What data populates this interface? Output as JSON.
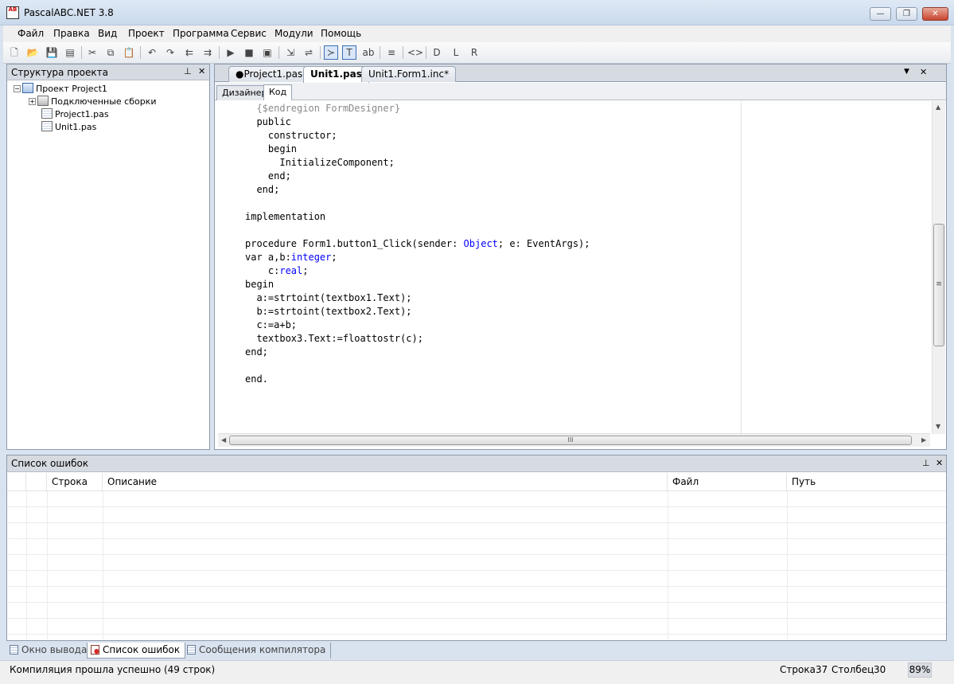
{
  "window": {
    "title": "PascalABC.NET 3.8",
    "icon_text": "AB",
    "minimize_glyph": "—",
    "restore_glyph": "❐",
    "close_glyph": "✕"
  },
  "menu": [
    "Файл",
    "Правка",
    "Вид",
    "Проект",
    "Программа",
    "Сервис",
    "Модули",
    "Помощь"
  ],
  "toolbar": {
    "icons": [
      "new-file-icon",
      "open-folder-icon",
      "save-icon",
      "save-all-icon",
      "cut-icon",
      "copy-icon",
      "paste-icon",
      "undo-icon",
      "redo-icon",
      "comment-icon",
      "uncomment-icon",
      "run-icon",
      "stop-icon",
      "debug-icon",
      "step-over-icon",
      "step-into-icon",
      "console-icon",
      "text-icon",
      "spell-icon",
      "format-icon",
      "code-icon",
      "design-d-icon",
      "design-l-icon",
      "design-r-icon"
    ],
    "glyphs": [
      "🗋",
      "📂",
      "💾",
      "▤",
      "✂",
      "⧉",
      "📋",
      "↶",
      "↷",
      "⇇",
      "⇉",
      "▶",
      "■",
      "▣",
      "⇲",
      "⇌",
      "≻",
      "T",
      "ab",
      "≡",
      "<>",
      "D",
      "L",
      "R"
    ]
  },
  "project_panel": {
    "title": "Структура проекта",
    "pin_glyph": "⊥",
    "close_glyph": "✕",
    "tree": [
      {
        "label": "Проект Project1",
        "expander": "−"
      },
      {
        "label": "Подключенные сборки",
        "expander": "+"
      },
      {
        "label": "Project1.pas"
      },
      {
        "label": "Unit1.pas"
      }
    ]
  },
  "editor": {
    "doc_tabs": [
      "●Project1.pas",
      "Unit1.pas",
      "Unit1.Form1.inc*"
    ],
    "active_doc_tab": "Unit1.pas",
    "dropdown_glyph": "▼",
    "close_glyph": "✕",
    "sub_tabs": [
      "Дизайнер",
      "Код"
    ],
    "active_sub_tab": "Код",
    "code_lines": [
      {
        "segments": [
          {
            "t": "  "
          },
          {
            "t": "{$endregion FormDesigner}",
            "c": "cmt"
          }
        ]
      },
      {
        "segments": [
          {
            "t": "  public"
          }
        ]
      },
      {
        "segments": [
          {
            "t": "    constructor;"
          }
        ]
      },
      {
        "segments": [
          {
            "t": "    begin"
          }
        ]
      },
      {
        "segments": [
          {
            "t": "      InitializeComponent;"
          }
        ]
      },
      {
        "segments": [
          {
            "t": "    end;"
          }
        ]
      },
      {
        "segments": [
          {
            "t": "  end;"
          }
        ]
      },
      {
        "segments": [
          {
            "t": ""
          }
        ]
      },
      {
        "segments": [
          {
            "t": "implementation"
          }
        ]
      },
      {
        "segments": [
          {
            "t": ""
          }
        ]
      },
      {
        "segments": [
          {
            "t": "procedure Form1.button1_Click(sender: "
          },
          {
            "t": "Object",
            "c": "kw-blue"
          },
          {
            "t": "; e: EventArgs);"
          }
        ]
      },
      {
        "segments": [
          {
            "t": "var a,b:"
          },
          {
            "t": "integer",
            "c": "kw-blue"
          },
          {
            "t": ";"
          }
        ]
      },
      {
        "segments": [
          {
            "t": "    c:"
          },
          {
            "t": "real",
            "c": "kw-blue"
          },
          {
            "t": ";"
          }
        ]
      },
      {
        "segments": [
          {
            "t": "begin"
          }
        ]
      },
      {
        "segments": [
          {
            "t": "  a:=strtoint(textbox1.Text);"
          }
        ]
      },
      {
        "segments": [
          {
            "t": "  b:=strtoint(textbox2.Text);"
          }
        ]
      },
      {
        "segments": [
          {
            "t": "  c:=a+b;"
          }
        ]
      },
      {
        "segments": [
          {
            "t": "  textbox3.Text:=floattostr(c);"
          }
        ]
      },
      {
        "segments": [
          {
            "t": "end;"
          }
        ]
      },
      {
        "segments": [
          {
            "t": ""
          }
        ]
      },
      {
        "segments": [
          {
            "t": "end."
          }
        ]
      }
    ],
    "scroll_grip": "≡",
    "hscroll_grip": "III"
  },
  "errors_panel": {
    "title": "Список ошибок",
    "pin_glyph": "⊥",
    "close_glyph": "✕",
    "columns": [
      "",
      "",
      "Строка",
      "Описание",
      "Файл",
      "Путь"
    ]
  },
  "bottom_tabs": [
    "Окно вывода",
    "Список ошибок",
    "Сообщения компилятора"
  ],
  "active_bottom_tab": "Список ошибок",
  "status": {
    "message": "Компиляция прошла успешно (49 строк)",
    "line_label": "Строка",
    "line_value": "37",
    "col_label": "Столбец",
    "col_value": "30",
    "zoom": "89%"
  },
  "colors": {
    "keyword_blue": "#0000ff",
    "comment_gray": "#8a8a8a",
    "panel_header": "#d6dbe2",
    "frame_bg": "#d9e3ef"
  }
}
